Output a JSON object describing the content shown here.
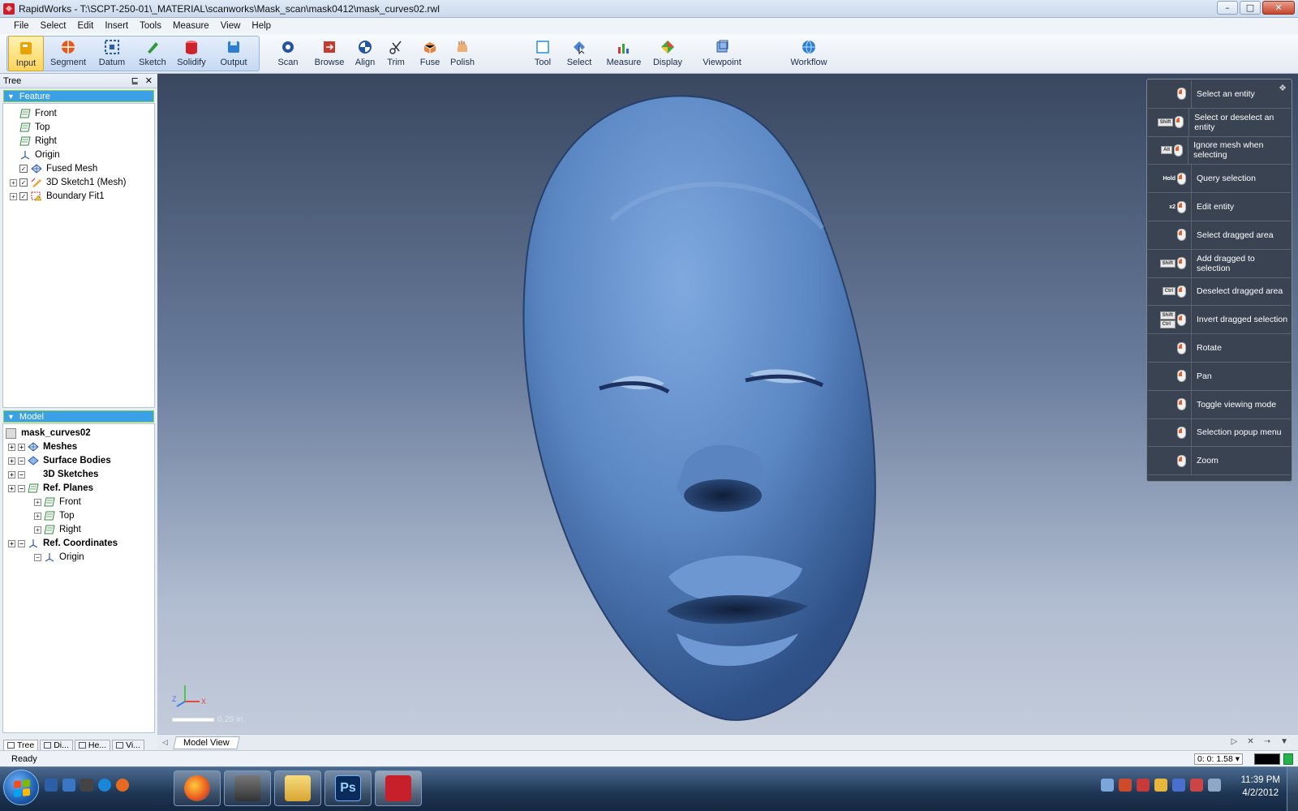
{
  "window": {
    "app_name": "RapidWorks",
    "title_path": "T:\\SCPT-250-01\\_MATERIAL\\scanworks\\Mask_scan\\mask0412\\mask_curves02.rwl",
    "controls": [
      "–",
      "□",
      "✕"
    ]
  },
  "menu": [
    "File",
    "Select",
    "Edit",
    "Insert",
    "Tools",
    "Measure",
    "View",
    "Help"
  ],
  "toolbar": {
    "group_buttons": [
      {
        "label": "Input",
        "icon": "input-folder-icon",
        "color": "#e8a400",
        "active": true
      },
      {
        "label": "Segment",
        "icon": "segment-icon",
        "color": "#e45a1c"
      },
      {
        "label": "Datum",
        "icon": "datum-icon",
        "color": "#2a5db0"
      },
      {
        "label": "Sketch",
        "icon": "sketch-pencil-icon",
        "color": "#2f9a3a"
      },
      {
        "label": "Solidify",
        "icon": "solidify-icon",
        "color": "#d0222a"
      },
      {
        "label": "Output",
        "icon": "output-disk-icon",
        "color": "#2a7fd0"
      }
    ],
    "tool_buttons": [
      {
        "label": "Scan",
        "icon": "scan-icon"
      },
      {
        "label": "Browse",
        "icon": "browse-icon"
      },
      {
        "label": "Align",
        "icon": "align-icon"
      },
      {
        "label": "Trim",
        "icon": "trim-scissors-icon"
      },
      {
        "label": "Fuse",
        "icon": "fuse-icon"
      },
      {
        "label": "Polish",
        "icon": "polish-hand-icon"
      }
    ],
    "view_buttons": [
      {
        "label": "Tool",
        "icon": "tool-icon"
      },
      {
        "label": "Select",
        "icon": "select-icon"
      },
      {
        "label": "Measure",
        "icon": "measure-icon"
      },
      {
        "label": "Display",
        "icon": "display-icon"
      },
      {
        "label": "Viewpoint",
        "icon": "viewpoint-icon"
      }
    ],
    "workflow": {
      "label": "Workflow",
      "icon": "workflow-globe-icon"
    }
  },
  "tree_panel": {
    "title": "Tree",
    "header_icons": [
      "⊑",
      "✕"
    ],
    "feature_section": "Feature",
    "feature_items": [
      {
        "label": "Front",
        "icon": "plane-icon"
      },
      {
        "label": "Top",
        "icon": "plane-icon"
      },
      {
        "label": "Right",
        "icon": "plane-icon"
      },
      {
        "label": "Origin",
        "icon": "origin-icon"
      },
      {
        "label": "Fused Mesh",
        "icon": "mesh-icon",
        "checked": true
      },
      {
        "label": "3D Sketch1 (Mesh)",
        "icon": "sketch3d-icon",
        "checked": true,
        "expand": true
      },
      {
        "label": "Boundary Fit1",
        "icon": "warning-surface-icon",
        "checked": true,
        "expand": true
      }
    ],
    "model_section": "Model",
    "model_root": "mask_curves02",
    "model_items": [
      {
        "label": "Meshes",
        "icon": "mesh-icon",
        "level": 1
      },
      {
        "label": "Surface Bodies",
        "icon": "surface-body-icon",
        "level": 1
      },
      {
        "label": "3D Sketches",
        "icon": "empty-icon",
        "level": 1
      },
      {
        "label": "Ref. Planes",
        "icon": "plane-icon",
        "level": 1
      },
      {
        "label": "Front",
        "icon": "plane-icon",
        "level": 2
      },
      {
        "label": "Top",
        "icon": "plane-icon",
        "level": 2
      },
      {
        "label": "Right",
        "icon": "plane-icon",
        "level": 2
      },
      {
        "label": "Ref. Coordinates",
        "icon": "origin-icon",
        "level": 1
      },
      {
        "label": "Origin",
        "icon": "origin-icon",
        "level": 2
      }
    ],
    "bottom_tabs": [
      "Tree",
      "Di...",
      "He...",
      "Vi..."
    ]
  },
  "viewport": {
    "scale_label": "0.25 in.",
    "axis_x": "X",
    "axis_z": "Z"
  },
  "help_panel": {
    "rows": [
      {
        "keys": "",
        "label": "Select an entity"
      },
      {
        "keys": "Shift",
        "label": "Select or deselect an entity"
      },
      {
        "keys": "Alt",
        "label": "Ignore mesh when selecting"
      },
      {
        "keys": "Hold",
        "label": "Query selection"
      },
      {
        "keys": "x2",
        "label": "Edit entity"
      },
      {
        "keys": "",
        "label": "Select dragged area"
      },
      {
        "keys": "Shift",
        "label": "Add dragged to selection"
      },
      {
        "keys": "Ctrl",
        "label": "Deselect dragged area"
      },
      {
        "keys": "Shift Ctrl",
        "label": "Invert dragged selection"
      },
      {
        "keys": "",
        "label": "Rotate"
      },
      {
        "keys": "",
        "label": "Pan"
      },
      {
        "keys": "",
        "label": "Toggle viewing mode"
      },
      {
        "keys": "",
        "label": "Selection popup menu"
      },
      {
        "keys": "",
        "label": "Zoom"
      }
    ]
  },
  "view_tab": "Model View",
  "status": {
    "text": "Ready",
    "timer": "0: 0: 1.58"
  },
  "taskbar": {
    "apps": [
      {
        "name": "firefox",
        "icon": "firefox-icon"
      },
      {
        "name": "rapidworks-b",
        "icon": "rapidform-icon"
      },
      {
        "name": "explorer",
        "icon": "folder-icon"
      },
      {
        "name": "photoshop",
        "icon": "photoshop-icon",
        "text": "Ps"
      },
      {
        "name": "rapidworks",
        "icon": "rapidworks-icon",
        "active": true
      }
    ],
    "time": "11:39 PM",
    "date": "4/2/2012"
  }
}
